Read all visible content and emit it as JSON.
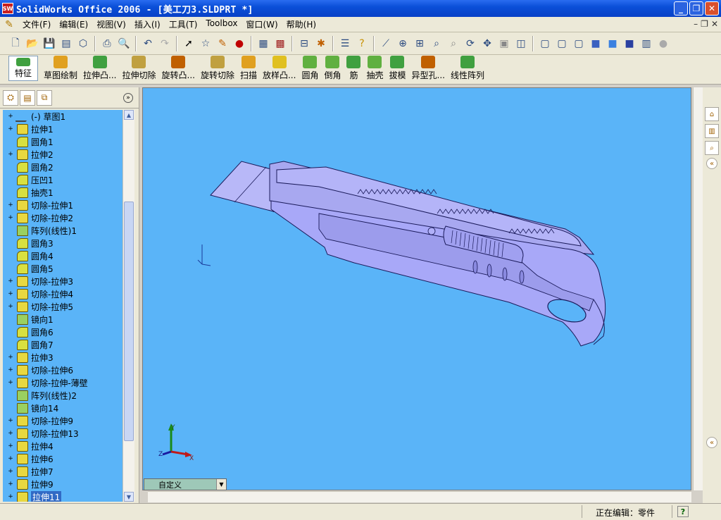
{
  "window": {
    "title": "SolidWorks Office 2006 - [美工刀3.SLDPRT *]",
    "app_icon": "SW"
  },
  "menu": {
    "items": [
      "文件(F)",
      "编辑(E)",
      "视图(V)",
      "插入(I)",
      "工具(T)",
      "Toolbox",
      "窗口(W)",
      "帮助(H)"
    ]
  },
  "features_toolbar": {
    "buttons": [
      "特征",
      "草图绘制",
      "拉伸凸...",
      "拉伸切除",
      "旋转凸...",
      "旋转切除",
      "扫描",
      "放样凸...",
      "圆角",
      "倒角",
      "筋",
      "抽壳",
      "拔模",
      "异型孔...",
      "线性阵列"
    ]
  },
  "feature_tree": {
    "items": [
      {
        "label": "(-) 草图1",
        "type": "sketch",
        "expand": true
      },
      {
        "label": "拉伸1",
        "type": "extrude",
        "expand": true
      },
      {
        "label": "圆角1",
        "type": "fillet",
        "expand": false
      },
      {
        "label": "拉伸2",
        "type": "extrude",
        "expand": true
      },
      {
        "label": "圆角2",
        "type": "fillet",
        "expand": false
      },
      {
        "label": "压凹1",
        "type": "indent",
        "expand": false
      },
      {
        "label": "抽壳1",
        "type": "shell",
        "expand": false
      },
      {
        "label": "切除-拉伸1",
        "type": "cut",
        "expand": true
      },
      {
        "label": "切除-拉伸2",
        "type": "cut",
        "expand": true
      },
      {
        "label": "阵列(线性)1",
        "type": "pattern",
        "expand": false
      },
      {
        "label": "圆角3",
        "type": "fillet",
        "expand": false
      },
      {
        "label": "圆角4",
        "type": "fillet",
        "expand": false
      },
      {
        "label": "圆角5",
        "type": "fillet",
        "expand": false
      },
      {
        "label": "切除-拉伸3",
        "type": "cut",
        "expand": true
      },
      {
        "label": "切除-拉伸4",
        "type": "cut",
        "expand": true
      },
      {
        "label": "切除-拉伸5",
        "type": "cut",
        "expand": true
      },
      {
        "label": "镜向1",
        "type": "mirror",
        "expand": false
      },
      {
        "label": "圆角6",
        "type": "fillet",
        "expand": false
      },
      {
        "label": "圆角7",
        "type": "fillet",
        "expand": false
      },
      {
        "label": "拉伸3",
        "type": "extrude",
        "expand": true
      },
      {
        "label": "切除-拉伸6",
        "type": "cut",
        "expand": true
      },
      {
        "label": "切除-拉伸-薄壁",
        "type": "cut",
        "expand": true
      },
      {
        "label": "阵列(线性)2",
        "type": "pattern",
        "expand": false
      },
      {
        "label": "镜向14",
        "type": "mirror",
        "expand": false
      },
      {
        "label": "切除-拉伸9",
        "type": "cut",
        "expand": true
      },
      {
        "label": "切除-拉伸13",
        "type": "cut",
        "expand": true
      },
      {
        "label": "拉伸4",
        "type": "extrude",
        "expand": true
      },
      {
        "label": "拉伸6",
        "type": "extrude",
        "expand": true
      },
      {
        "label": "拉伸7",
        "type": "extrude",
        "expand": true
      },
      {
        "label": "拉伸9",
        "type": "extrude",
        "expand": true
      },
      {
        "label": "拉伸11",
        "type": "extrude",
        "expand": true,
        "selected": true
      }
    ]
  },
  "viewport": {
    "background": "#5ab4f8",
    "view_selector": "自定义",
    "triad_labels": [
      "Y",
      "X",
      "Z"
    ]
  },
  "status": {
    "text": "正在编辑：零件",
    "help": "?"
  },
  "colors": {
    "model": "#a8a8f8",
    "model_edge": "#1a1a5a",
    "tree_bg": "#5ab4f8"
  }
}
